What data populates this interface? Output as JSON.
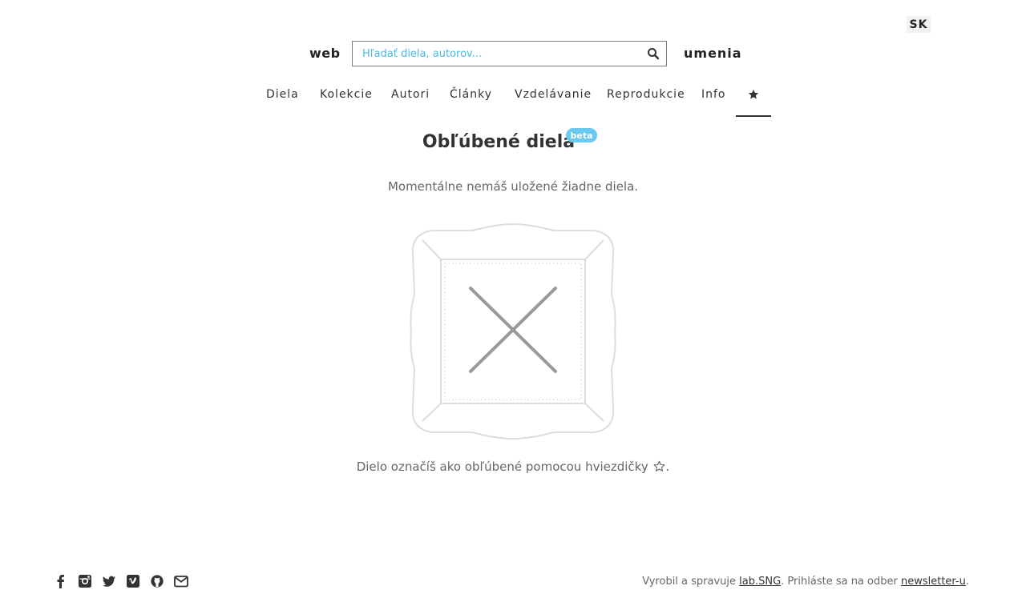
{
  "language": {
    "current": "SK"
  },
  "header": {
    "brand_left": "web",
    "brand_right": "umenia",
    "search": {
      "placeholder": "Hľadať diela, autorov...",
      "value": ""
    }
  },
  "nav": {
    "items": [
      "Diela",
      "Kolekcie",
      "Autori",
      "Články",
      "Vzdelávanie",
      "Reprodukcie",
      "Info"
    ],
    "active": "favorites-star"
  },
  "main": {
    "title": "Obľúbené diela",
    "badge": "beta",
    "empty_message": "Momentálne nemáš uložené žiadne diela.",
    "placeholder_icon": "empty-frame-icon",
    "hint": "Dielo označíš ako obľúbené pomocou hviezdičky",
    "hint_end": "."
  },
  "footer": {
    "social_icons": [
      "facebook-icon",
      "instagram-icon",
      "twitter-icon",
      "vimeo-icon",
      "github-icon",
      "envelope-icon"
    ],
    "text_1": "Vyrobil a spravuje ",
    "link_lab": "lab.SNG",
    "text_2": ". Prihláste sa na odber ",
    "link_newsletter": "newsletter-u",
    "text_3": "."
  },
  "colors": {
    "accent": "#4ab9e6",
    "badge": "#6ac9ee",
    "text": "#333333",
    "muted": "#666666"
  }
}
